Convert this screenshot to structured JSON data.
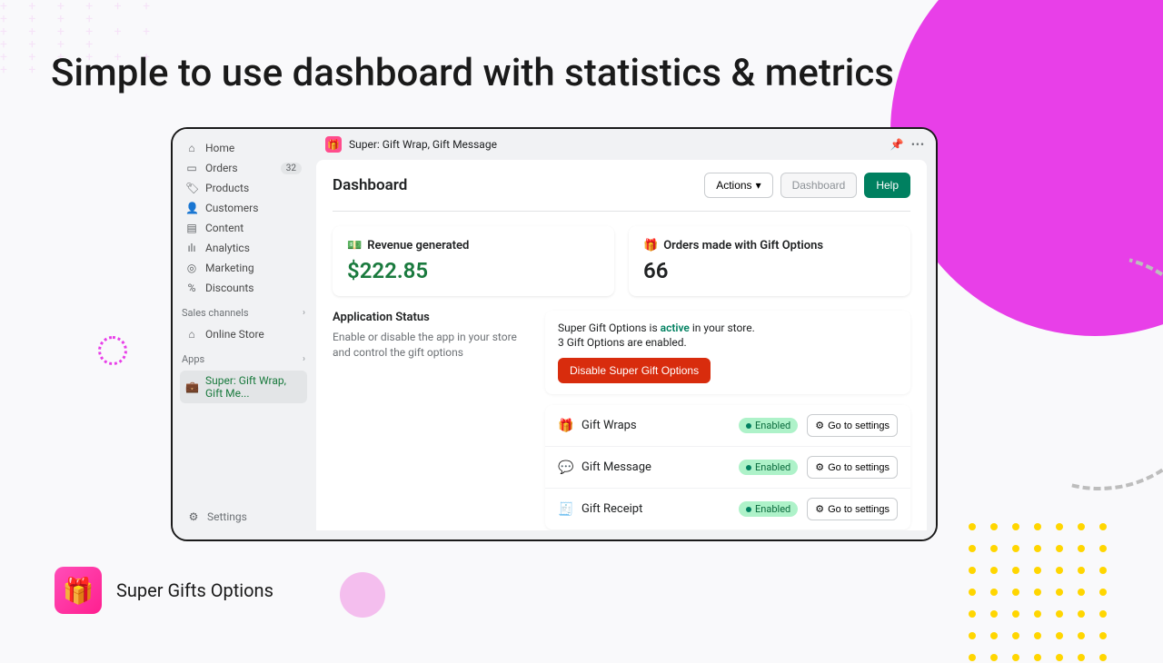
{
  "headline": "Simple to use dashboard with statistics & metrics",
  "sidebar": {
    "items": [
      {
        "label": "Home"
      },
      {
        "label": "Orders",
        "badge": "32"
      },
      {
        "label": "Products"
      },
      {
        "label": "Customers"
      },
      {
        "label": "Content"
      },
      {
        "label": "Analytics"
      },
      {
        "label": "Marketing"
      },
      {
        "label": "Discounts"
      }
    ],
    "sales_heading": "Sales channels",
    "sales_items": [
      {
        "label": "Online Store"
      }
    ],
    "apps_heading": "Apps",
    "apps_items": [
      {
        "label": "Super: Gift Wrap, Gift Me..."
      }
    ],
    "settings_label": "Settings"
  },
  "appbar": {
    "title": "Super: Gift Wrap, Gift Message"
  },
  "page": {
    "title": "Dashboard",
    "actions_label": "Actions",
    "dashboard_btn": "Dashboard",
    "help_btn": "Help"
  },
  "stats": {
    "revenue": {
      "label": "Revenue generated",
      "value": "$222.85"
    },
    "orders": {
      "label": "Orders made with Gift Options",
      "value": "66"
    }
  },
  "status": {
    "heading": "Application Status",
    "description": "Enable or disable the app in your store and control the gift options",
    "line1_pre": "Super Gift Options is ",
    "line1_active": "active",
    "line1_post": " in your store.",
    "line2_count": "3",
    "line2_post": " Gift Options are enabled.",
    "disable_btn": "Disable Super Gift Options"
  },
  "options": [
    {
      "label": "Gift Wraps",
      "status": "Enabled",
      "settings_label": "Go to settings"
    },
    {
      "label": "Gift Message",
      "status": "Enabled",
      "settings_label": "Go to settings"
    },
    {
      "label": "Gift Receipt",
      "status": "Enabled",
      "settings_label": "Go to settings"
    }
  ],
  "footer": {
    "brand": "Super Gifts Options"
  }
}
